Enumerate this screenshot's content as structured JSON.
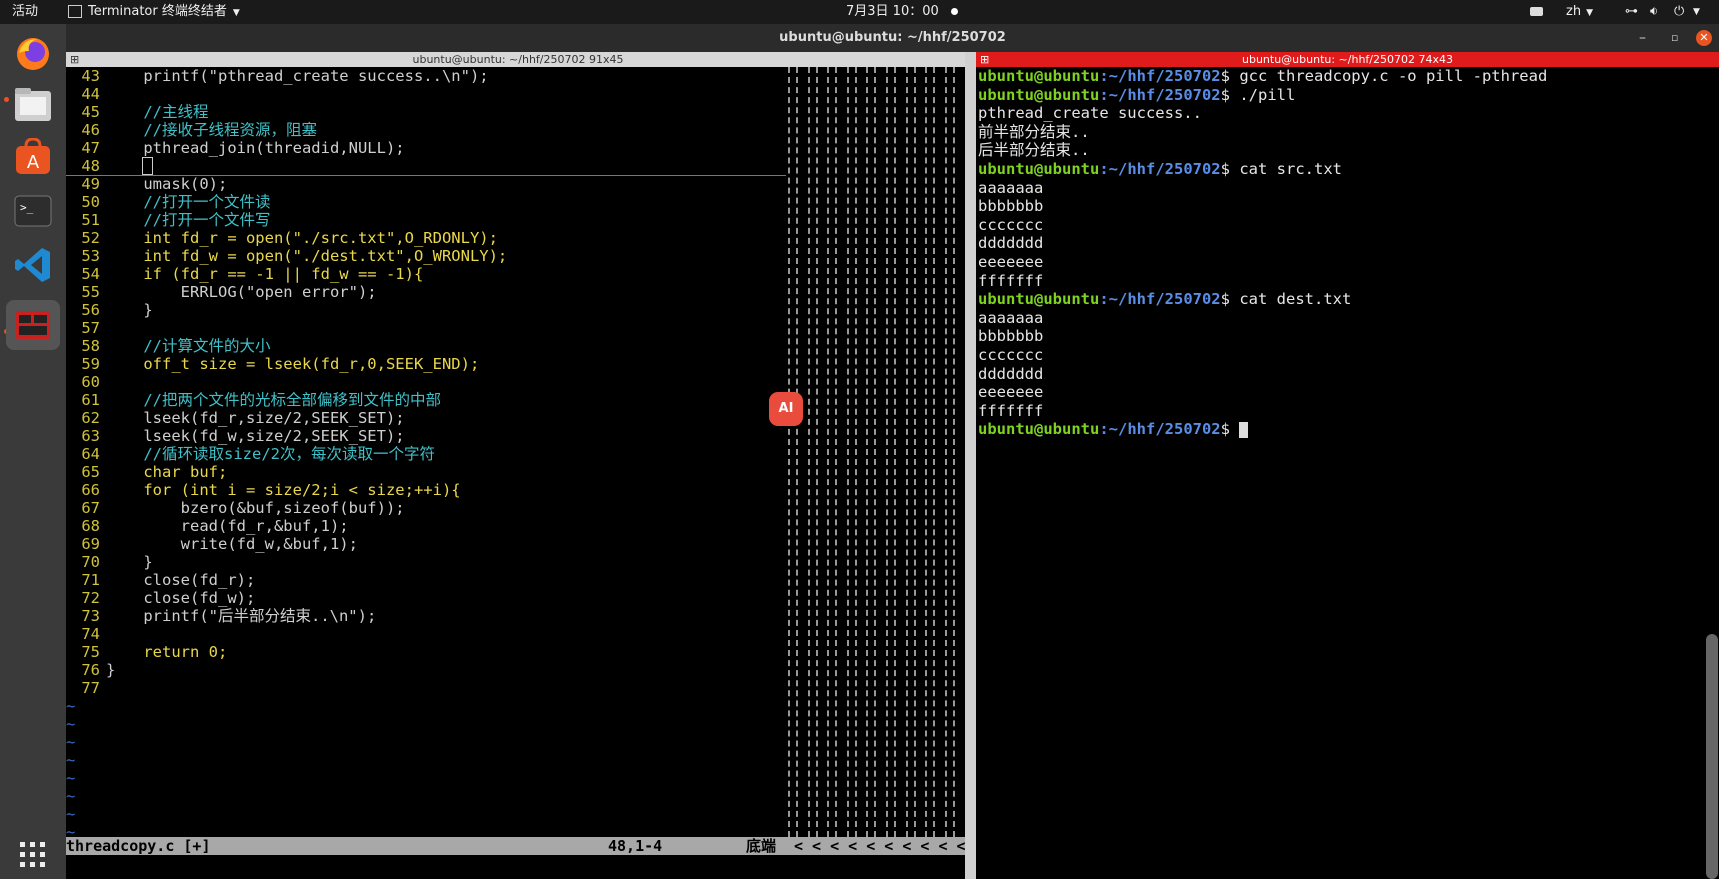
{
  "topbar": {
    "activities": "活动",
    "app_name": "Terminator 终端终结者",
    "clock": "7月3日 10：00",
    "lang": "zh"
  },
  "window": {
    "title": "ubuntu@ubuntu: ~/hhf/250702",
    "left_pane_title": "ubuntu@ubuntu: ~/hhf/250702 91x45",
    "right_pane_title": "ubuntu@ubuntu: ~/hhf/250702 74x43"
  },
  "dock": [
    "firefox-icon",
    "files-icon",
    "software-icon",
    "terminal-icon",
    "vscode-icon",
    "terminator-icon",
    "app-grid-icon"
  ],
  "vim": {
    "lines": [
      {
        "n": "43",
        "t": "    printf(\"pthread_create success..\\n\");"
      },
      {
        "n": "44",
        "t": ""
      },
      {
        "n": "45",
        "t": "    //主线程"
      },
      {
        "n": "46",
        "t": "    //接收子线程资源，阻塞"
      },
      {
        "n": "47",
        "t": "    pthread_join(threadid,NULL);"
      },
      {
        "n": "48",
        "t": "    "
      },
      {
        "n": "49",
        "t": "    umask(0);"
      },
      {
        "n": "50",
        "t": "    //打开一个文件读"
      },
      {
        "n": "51",
        "t": "    //打开一个文件写"
      },
      {
        "n": "52",
        "t": "    int fd_r = open(\"./src.txt\",O_RDONLY);"
      },
      {
        "n": "53",
        "t": "    int fd_w = open(\"./dest.txt\",O_WRONLY);"
      },
      {
        "n": "54",
        "t": "    if (fd_r == -1 || fd_w == -1){"
      },
      {
        "n": "55",
        "t": "        ERRLOG(\"open error\");"
      },
      {
        "n": "56",
        "t": "    }"
      },
      {
        "n": "57",
        "t": ""
      },
      {
        "n": "58",
        "t": "    //计算文件的大小"
      },
      {
        "n": "59",
        "t": "    off_t size = lseek(fd_r,0,SEEK_END);"
      },
      {
        "n": "60",
        "t": ""
      },
      {
        "n": "61",
        "t": "    //把两个文件的光标全部偏移到文件的中部"
      },
      {
        "n": "62",
        "t": "    lseek(fd_r,size/2,SEEK_SET);"
      },
      {
        "n": "63",
        "t": "    lseek(fd_w,size/2,SEEK_SET);"
      },
      {
        "n": "64",
        "t": "    //循环读取size/2次，每次读取一个字符"
      },
      {
        "n": "65",
        "t": "    char buf;"
      },
      {
        "n": "66",
        "t": "    for (int i = size/2;i < size;++i){"
      },
      {
        "n": "67",
        "t": "        bzero(&buf,sizeof(buf));"
      },
      {
        "n": "68",
        "t": "        read(fd_r,&buf,1);"
      },
      {
        "n": "69",
        "t": "        write(fd_w,&buf,1);"
      },
      {
        "n": "70",
        "t": "    }"
      },
      {
        "n": "71",
        "t": "    close(fd_r);"
      },
      {
        "n": "72",
        "t": "    close(fd_w);"
      },
      {
        "n": "73",
        "t": "    printf(\"后半部分结束..\\n\");"
      },
      {
        "n": "74",
        "t": ""
      },
      {
        "n": "75",
        "t": "    return 0;"
      },
      {
        "n": "76",
        "t": "}"
      },
      {
        "n": "77",
        "t": ""
      }
    ],
    "tilde_count": 8,
    "status_file": "threadcopy.c [+]",
    "status_pos": "48,1-4",
    "status_scroll": "底端",
    "status_tail": "< < < < < < < < < <"
  },
  "terminal": {
    "prompt_user": "ubuntu@ubuntu",
    "prompt_path": ":~/hhf/250702",
    "prompt_sym": "$ ",
    "lines": [
      {
        "type": "cmd",
        "text": "gcc threadcopy.c -o pill -pthread"
      },
      {
        "type": "cmd",
        "text": "./pill"
      },
      {
        "type": "out",
        "text": "pthread_create success.."
      },
      {
        "type": "out",
        "text": "前半部分结束.."
      },
      {
        "type": "out",
        "text": "后半部分结束.."
      },
      {
        "type": "cmd",
        "text": "cat src.txt"
      },
      {
        "type": "out",
        "text": "aaaaaaa"
      },
      {
        "type": "out",
        "text": "bbbbbbb"
      },
      {
        "type": "out",
        "text": "ccccccc"
      },
      {
        "type": "out",
        "text": "ddddddd"
      },
      {
        "type": "out",
        "text": "eeeeeee"
      },
      {
        "type": "out",
        "text": "fffffff"
      },
      {
        "type": "cmd",
        "text": "cat dest.txt"
      },
      {
        "type": "out",
        "text": "aaaaaaa"
      },
      {
        "type": "out",
        "text": "bbbbbbb"
      },
      {
        "type": "out",
        "text": "ccccccc"
      },
      {
        "type": "out",
        "text": "ddddddd"
      },
      {
        "type": "out",
        "text": "eeeeeee"
      },
      {
        "type": "out",
        "text": "fffffff"
      },
      {
        "type": "cmd",
        "text": ""
      }
    ]
  },
  "ai_button": "AI"
}
